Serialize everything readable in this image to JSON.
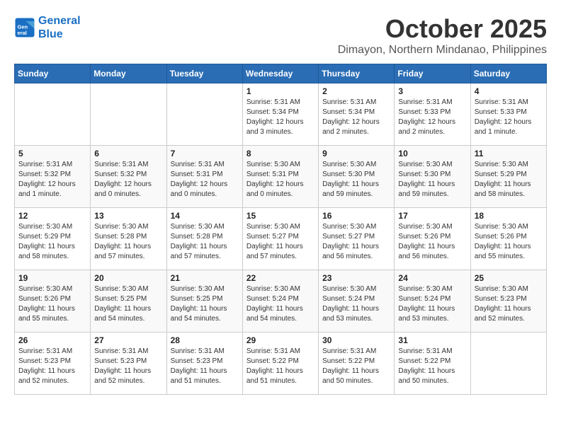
{
  "logo": {
    "line1": "General",
    "line2": "Blue"
  },
  "title": "October 2025",
  "subtitle": "Dimayon, Northern Mindanao, Philippines",
  "weekdays": [
    "Sunday",
    "Monday",
    "Tuesday",
    "Wednesday",
    "Thursday",
    "Friday",
    "Saturday"
  ],
  "weeks": [
    [
      {
        "day": "",
        "info": ""
      },
      {
        "day": "",
        "info": ""
      },
      {
        "day": "",
        "info": ""
      },
      {
        "day": "1",
        "info": "Sunrise: 5:31 AM\nSunset: 5:34 PM\nDaylight: 12 hours and 3 minutes."
      },
      {
        "day": "2",
        "info": "Sunrise: 5:31 AM\nSunset: 5:34 PM\nDaylight: 12 hours and 2 minutes."
      },
      {
        "day": "3",
        "info": "Sunrise: 5:31 AM\nSunset: 5:33 PM\nDaylight: 12 hours and 2 minutes."
      },
      {
        "day": "4",
        "info": "Sunrise: 5:31 AM\nSunset: 5:33 PM\nDaylight: 12 hours and 1 minute."
      }
    ],
    [
      {
        "day": "5",
        "info": "Sunrise: 5:31 AM\nSunset: 5:32 PM\nDaylight: 12 hours and 1 minute."
      },
      {
        "day": "6",
        "info": "Sunrise: 5:31 AM\nSunset: 5:32 PM\nDaylight: 12 hours and 0 minutes."
      },
      {
        "day": "7",
        "info": "Sunrise: 5:31 AM\nSunset: 5:31 PM\nDaylight: 12 hours and 0 minutes."
      },
      {
        "day": "8",
        "info": "Sunrise: 5:30 AM\nSunset: 5:31 PM\nDaylight: 12 hours and 0 minutes."
      },
      {
        "day": "9",
        "info": "Sunrise: 5:30 AM\nSunset: 5:30 PM\nDaylight: 11 hours and 59 minutes."
      },
      {
        "day": "10",
        "info": "Sunrise: 5:30 AM\nSunset: 5:30 PM\nDaylight: 11 hours and 59 minutes."
      },
      {
        "day": "11",
        "info": "Sunrise: 5:30 AM\nSunset: 5:29 PM\nDaylight: 11 hours and 58 minutes."
      }
    ],
    [
      {
        "day": "12",
        "info": "Sunrise: 5:30 AM\nSunset: 5:29 PM\nDaylight: 11 hours and 58 minutes."
      },
      {
        "day": "13",
        "info": "Sunrise: 5:30 AM\nSunset: 5:28 PM\nDaylight: 11 hours and 57 minutes."
      },
      {
        "day": "14",
        "info": "Sunrise: 5:30 AM\nSunset: 5:28 PM\nDaylight: 11 hours and 57 minutes."
      },
      {
        "day": "15",
        "info": "Sunrise: 5:30 AM\nSunset: 5:27 PM\nDaylight: 11 hours and 57 minutes."
      },
      {
        "day": "16",
        "info": "Sunrise: 5:30 AM\nSunset: 5:27 PM\nDaylight: 11 hours and 56 minutes."
      },
      {
        "day": "17",
        "info": "Sunrise: 5:30 AM\nSunset: 5:26 PM\nDaylight: 11 hours and 56 minutes."
      },
      {
        "day": "18",
        "info": "Sunrise: 5:30 AM\nSunset: 5:26 PM\nDaylight: 11 hours and 55 minutes."
      }
    ],
    [
      {
        "day": "19",
        "info": "Sunrise: 5:30 AM\nSunset: 5:26 PM\nDaylight: 11 hours and 55 minutes."
      },
      {
        "day": "20",
        "info": "Sunrise: 5:30 AM\nSunset: 5:25 PM\nDaylight: 11 hours and 54 minutes."
      },
      {
        "day": "21",
        "info": "Sunrise: 5:30 AM\nSunset: 5:25 PM\nDaylight: 11 hours and 54 minutes."
      },
      {
        "day": "22",
        "info": "Sunrise: 5:30 AM\nSunset: 5:24 PM\nDaylight: 11 hours and 54 minutes."
      },
      {
        "day": "23",
        "info": "Sunrise: 5:30 AM\nSunset: 5:24 PM\nDaylight: 11 hours and 53 minutes."
      },
      {
        "day": "24",
        "info": "Sunrise: 5:30 AM\nSunset: 5:24 PM\nDaylight: 11 hours and 53 minutes."
      },
      {
        "day": "25",
        "info": "Sunrise: 5:30 AM\nSunset: 5:23 PM\nDaylight: 11 hours and 52 minutes."
      }
    ],
    [
      {
        "day": "26",
        "info": "Sunrise: 5:31 AM\nSunset: 5:23 PM\nDaylight: 11 hours and 52 minutes."
      },
      {
        "day": "27",
        "info": "Sunrise: 5:31 AM\nSunset: 5:23 PM\nDaylight: 11 hours and 52 minutes."
      },
      {
        "day": "28",
        "info": "Sunrise: 5:31 AM\nSunset: 5:23 PM\nDaylight: 11 hours and 51 minutes."
      },
      {
        "day": "29",
        "info": "Sunrise: 5:31 AM\nSunset: 5:22 PM\nDaylight: 11 hours and 51 minutes."
      },
      {
        "day": "30",
        "info": "Sunrise: 5:31 AM\nSunset: 5:22 PM\nDaylight: 11 hours and 50 minutes."
      },
      {
        "day": "31",
        "info": "Sunrise: 5:31 AM\nSunset: 5:22 PM\nDaylight: 11 hours and 50 minutes."
      },
      {
        "day": "",
        "info": ""
      }
    ]
  ]
}
